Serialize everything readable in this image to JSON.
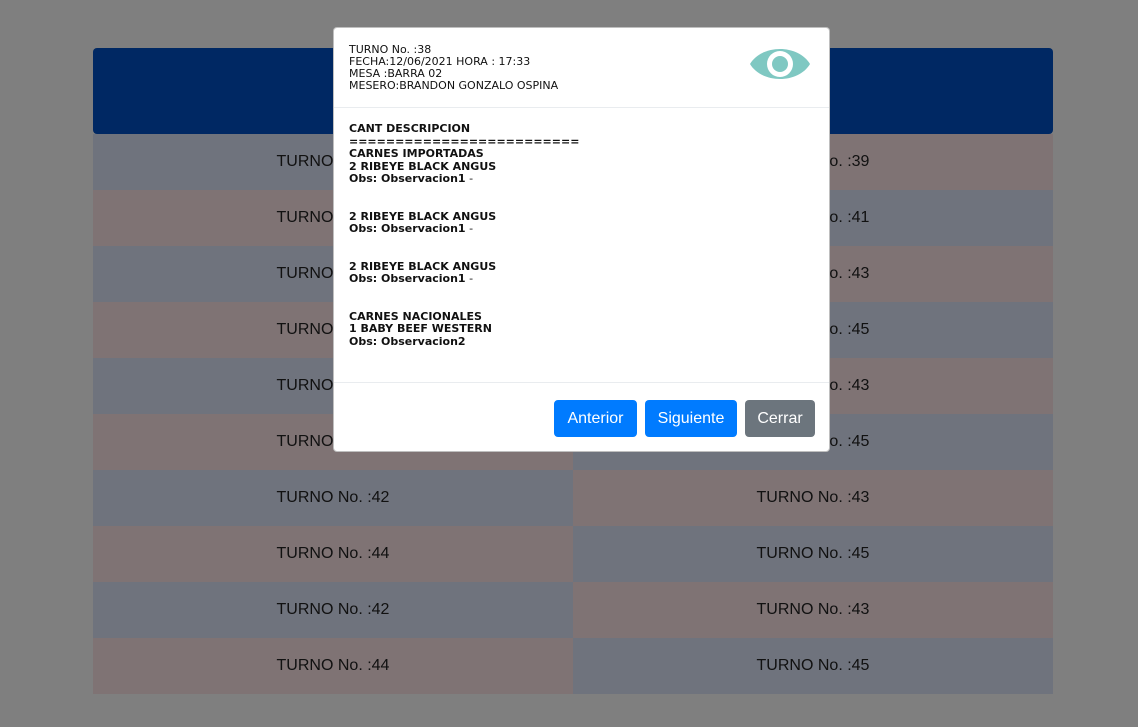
{
  "colors": {
    "header_blue": "#0051c6",
    "cell_blue": "#dfe6fb",
    "cell_pink": "#ffe6e9",
    "primary_button": "#007bff",
    "secondary_button": "#6c757d",
    "eye_icon": "#7fc8c2"
  },
  "background_table": {
    "rows": [
      {
        "left": "TURNO No. :38",
        "right": "TURNO No. :39"
      },
      {
        "left": "TURNO No. :40",
        "right": "TURNO No. :41"
      },
      {
        "left": "TURNO No. :42",
        "right": "TURNO No. :43"
      },
      {
        "left": "TURNO No. :44",
        "right": "TURNO No. :45"
      },
      {
        "left": "TURNO No. :42",
        "right": "TURNO No. :43"
      },
      {
        "left": "TURNO No. :44",
        "right": "TURNO No. :45"
      },
      {
        "left": "TURNO No. :42",
        "right": "TURNO No. :43"
      },
      {
        "left": "TURNO No. :44",
        "right": "TURNO No. :45"
      },
      {
        "left": "TURNO No. :42",
        "right": "TURNO No. :43"
      },
      {
        "left": "TURNO No. :44",
        "right": "TURNO No. :45"
      }
    ]
  },
  "modal": {
    "header": {
      "turno": "TURNO No. :38",
      "fecha": "FECHA:12/06/2021 HORA : 17:33",
      "mesa": "MESA :BARRA 02",
      "mesero": "MESERO:BRANDON GONZALO OSPINA",
      "icon": "eye-icon"
    },
    "body": {
      "columns": "CANT DESCRIPCION",
      "separator": "=========================",
      "category1": "CARNES IMPORTADAS",
      "item1": "2 RIBEYE BLACK ANGUS",
      "obs1": "Obs: Observacion1",
      "obs1_note": " -",
      "item2": "2 RIBEYE BLACK ANGUS",
      "obs2": "Obs: Observacion1",
      "obs2_note": " -",
      "item3": "2 RIBEYE BLACK ANGUS",
      "obs3": "Obs: Observacion1",
      "obs3_note": " -",
      "category2": "CARNES NACIONALES",
      "item4": "1 BABY BEEF WESTERN",
      "obs4": "Obs: Observacion2"
    },
    "footer": {
      "anterior": "Anterior",
      "siguiente": "Siguiente",
      "cerrar": "Cerrar"
    }
  }
}
